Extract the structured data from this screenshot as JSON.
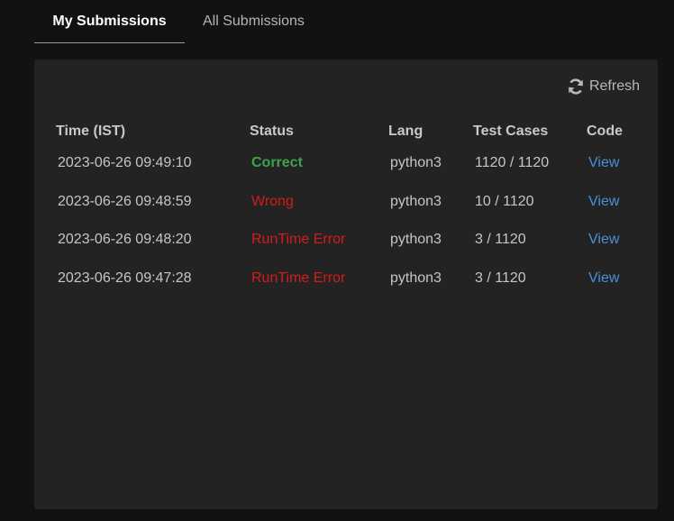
{
  "tabs": [
    {
      "label": "My Submissions",
      "active": true
    },
    {
      "label": "All Submissions",
      "active": false
    }
  ],
  "toolbar": {
    "refresh_label": "Refresh",
    "refresh_icon": "refresh-icon"
  },
  "table": {
    "columns": [
      "Time (IST)",
      "Status",
      "Lang",
      "Test Cases",
      "Code"
    ],
    "rows": [
      {
        "time": "2023-06-26 09:49:10",
        "status": "Correct",
        "status_type": "correct",
        "lang": "python3",
        "tests": "1120 / 1120",
        "code": "View"
      },
      {
        "time": "2023-06-26 09:48:59",
        "status": "Wrong",
        "status_type": "error",
        "lang": "python3",
        "tests": "10 / 1120",
        "code": "View"
      },
      {
        "time": "2023-06-26 09:48:20",
        "status": "RunTime Error",
        "status_type": "error",
        "lang": "python3",
        "tests": "3 / 1120",
        "code": "View"
      },
      {
        "time": "2023-06-26 09:47:28",
        "status": "RunTime Error",
        "status_type": "error",
        "lang": "python3",
        "tests": "3 / 1120",
        "code": "View"
      }
    ]
  },
  "colors": {
    "background": "#121212",
    "panel": "#232323",
    "correct": "#3fa34d",
    "error": "#d41c1c",
    "link": "#4a90d9"
  }
}
